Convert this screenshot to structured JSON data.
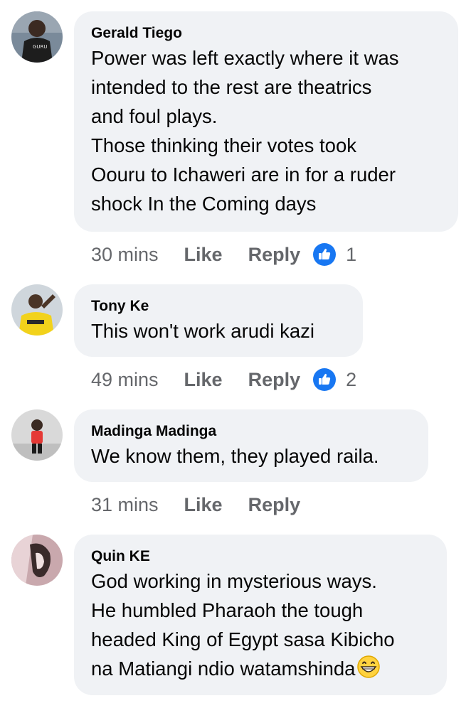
{
  "comments": [
    {
      "author": "Gerald Tiego",
      "text": "Power was left exactly where it was\nintended to the rest are theatrics\nand foul plays.\nThose thinking their votes took\nOouru to Ichaweri are in for a ruder\nshock In the Coming days",
      "time": "30 mins",
      "like_label": "Like",
      "reply_label": "Reply",
      "reaction_count": "1",
      "reaction_icon": "thumbs-up-icon",
      "avatar_colors": [
        "#7a8a9a",
        "#1d1d1d",
        "#e6e6e6"
      ]
    },
    {
      "author": "Tony Ke",
      "text": "This won't work arudi kazi",
      "time": "49 mins",
      "like_label": "Like",
      "reply_label": "Reply",
      "reaction_count": "2",
      "reaction_icon": "thumbs-up-icon",
      "avatar_colors": [
        "#cfd6dc",
        "#f2d21b",
        "#2a2a2a"
      ]
    },
    {
      "author": "Madinga Madinga",
      "text": "We know them, they played raila.",
      "time": "31 mins",
      "like_label": "Like",
      "reply_label": "Reply",
      "avatar_colors": [
        "#d9d9d9",
        "#e53935",
        "#1a1a1a"
      ]
    },
    {
      "author": "Quin KE",
      "text": "God working in mysterious ways.\nHe humbled Pharaoh the tough\nheaded King of Egypt sasa Kibicho\nna Matiangi ndio watamshinda",
      "emoji": "grinning-face-emoji",
      "avatar_colors": [
        "#c9a8ad",
        "#3a2a2a",
        "#f0e0e0"
      ]
    }
  ],
  "colors": {
    "bubble": "#f0f2f5",
    "meta_text": "#65676b",
    "reaction_blue": "#1877f2"
  }
}
